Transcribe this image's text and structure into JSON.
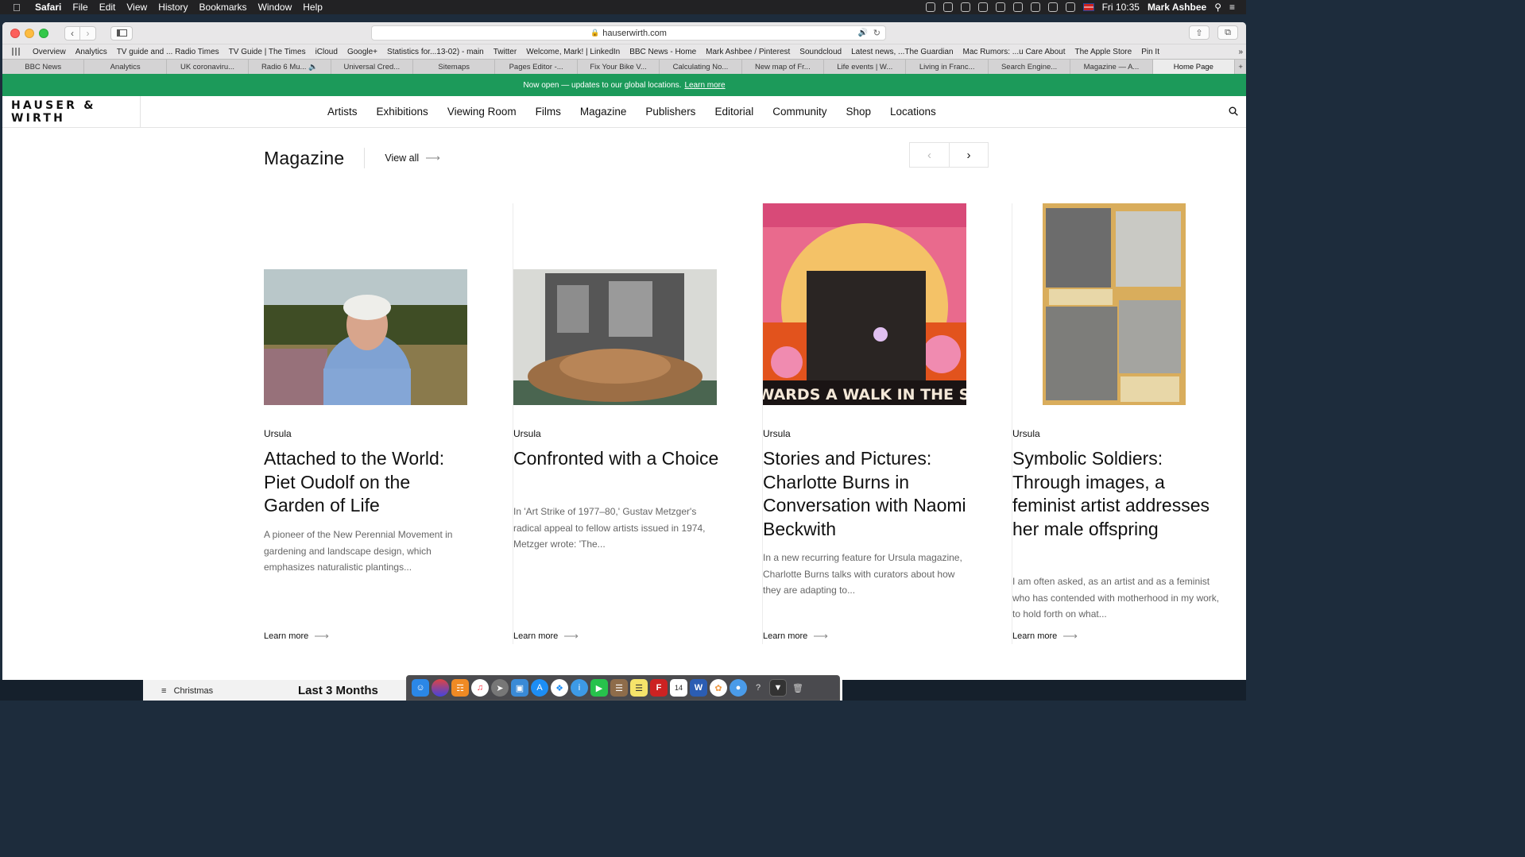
{
  "menubar": {
    "items": [
      "Safari",
      "File",
      "Edit",
      "View",
      "History",
      "Bookmarks",
      "Window",
      "Help"
    ],
    "clock": "Fri 10:35",
    "user": "Mark Ashbee"
  },
  "browser": {
    "url": "hauserwirth.com",
    "favorites": [
      "Overview",
      "Analytics",
      "TV guide and ... Radio Times",
      "TV Guide | The Times",
      "iCloud",
      "Google+",
      "Statistics for...13-02) - main",
      "Twitter",
      "Welcome, Mark! | LinkedIn",
      "BBC News - Home",
      "Mark Ashbee / Pinterest",
      "Soundcloud",
      "Latest news, ...The Guardian",
      "Mac Rumors: ...u Care About",
      "The Apple Store",
      "Pin It"
    ],
    "tabs": [
      "BBC News",
      "Analytics",
      "UK coronaviru...",
      "Radio 6 Mu...",
      "Universal Cred...",
      "Sitemaps",
      "Pages Editor -...",
      "Fix Your Bike V...",
      "Calculating No...",
      "New map of Fr...",
      "Life events | W...",
      "Living in Franc...",
      "Search Engine...",
      "Magazine — A...",
      "Home Page"
    ]
  },
  "banner": {
    "text": "Now open — updates to our global locations.",
    "link": "Learn more"
  },
  "site": {
    "logo": "HAUSER & WIRTH",
    "nav": [
      "Artists",
      "Exhibitions",
      "Viewing Room",
      "Films",
      "Magazine",
      "Publishers",
      "Editorial",
      "Community",
      "Shop",
      "Locations"
    ]
  },
  "magazine": {
    "heading": "Magazine",
    "view_all": "View all",
    "cards": [
      {
        "category": "Ursula",
        "title": "Attached to the World: Piet Oudolf on the Garden of Life",
        "excerpt": "A pioneer of the New Perennial Movement in gardening and landscape design, which emphasizes naturalistic plantings...",
        "link": "Learn more"
      },
      {
        "category": "Ursula",
        "title": "Confronted with a Choice",
        "excerpt": "In 'Art Strike of 1977–80,' Gustav Metzger's radical appeal to fellow artists issued in 1974, Metzger wrote: 'The...",
        "link": "Learn more"
      },
      {
        "category": "Ursula",
        "title": "Stories and Pictures: Charlotte Burns in Conversation with Naomi Beckwith",
        "excerpt": "In a new recurring feature for Ursula magazine, Charlotte Burns talks with curators about how they are adapting to...",
        "link": "Learn more",
        "image_text": "TOWARDS A WALK IN THE SUN"
      },
      {
        "category": "Ursula",
        "title": "Symbolic Soldiers: Through images, a feminist artist addresses her male offspring",
        "excerpt": "I am often asked, as an artist and as a feminist who has contended with motherhood in my work, to hold forth on what...",
        "link": "Learn more"
      }
    ]
  },
  "desktop": {
    "sidebar_item": "Christmas",
    "heading": "Last 3 Months",
    "calendar_day": "14"
  },
  "colors": {
    "banner": "#1c9a5a"
  }
}
